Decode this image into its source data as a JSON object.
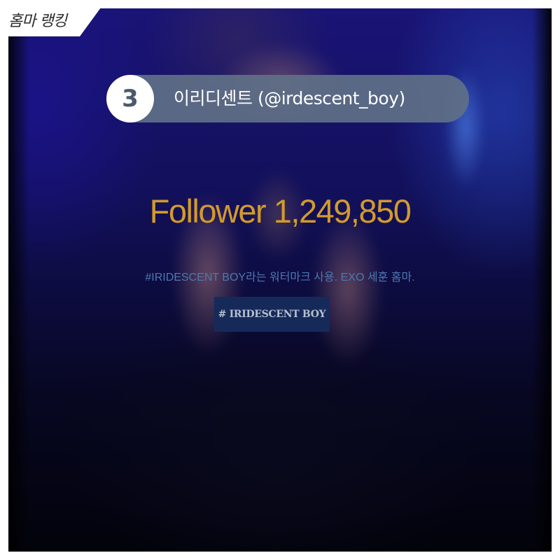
{
  "header": {
    "category_tag": "홈마 랭킹"
  },
  "ranking": {
    "rank": "3",
    "name": "이리디센트 (@irdescent_boy)",
    "follower_text": "Follower 1,249,850",
    "description": "#IRIDESCENT BOY라는 워터마크 사용. EXO 세훈 홈마.",
    "watermark_text": "# IRIDESCENT BOY"
  },
  "colors": {
    "accent_gold": "#d39a2c",
    "pill": "#5f7087",
    "description_blue": "#4e78b0",
    "watermark_bg": "#162a5a"
  }
}
